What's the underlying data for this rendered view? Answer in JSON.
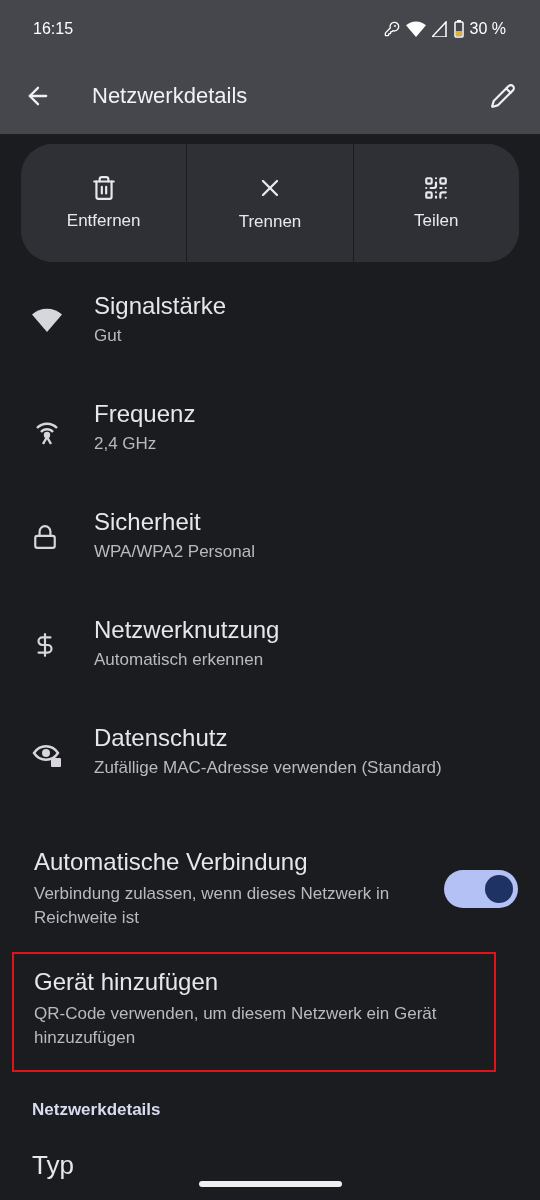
{
  "status_bar": {
    "time": "16:15",
    "battery": "30 %"
  },
  "app_bar": {
    "title": "Netzwerkdetails"
  },
  "actions": [
    {
      "label": "Entfernen"
    },
    {
      "label": "Trennen"
    },
    {
      "label": "Teilen"
    }
  ],
  "details": [
    {
      "title": "Signalstärke",
      "value": "Gut"
    },
    {
      "title": "Frequenz",
      "value": "2,4 GHz"
    },
    {
      "title": "Sicherheit",
      "value": "WPA/WPA2 Personal"
    },
    {
      "title": "Netzwerknutzung",
      "value": "Automatisch erkennen"
    },
    {
      "title": "Datenschutz",
      "value": "Zufällige MAC-Adresse verwenden (Standard)"
    }
  ],
  "settings": [
    {
      "kind": "toggle",
      "title": "Automatische Verbindung",
      "summary": "Verbindung zulassen, wenn dieses Netzwerk in Reichweite ist",
      "on": true,
      "highlighted": false
    },
    {
      "kind": "link",
      "title": "Gerät hinzufügen",
      "summary": "QR-Code verwenden, um diesem Netzwerk ein Gerät hinzuzufügen",
      "highlighted": true
    }
  ],
  "section": {
    "heading": "Netzwerkdetails",
    "items": [
      {
        "title": "Typ"
      }
    ]
  }
}
